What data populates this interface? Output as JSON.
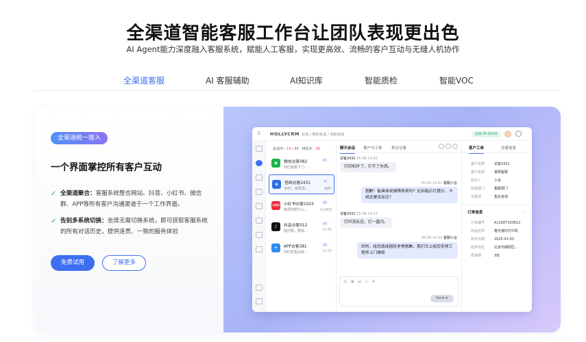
{
  "hero": {
    "title": "全渠道智能客服工作台让团队表现更出色",
    "subtitle": "AI Agent能力深度融入客服系统，赋能人工客服，实现更高效、流畅的客户互动与无缝人机协作"
  },
  "tabs": [
    {
      "label": "全渠道客服",
      "active": true
    },
    {
      "label": "AI 客服辅助",
      "active": false
    },
    {
      "label": "AI知识库",
      "active": false
    },
    {
      "label": "智能质检",
      "active": false
    },
    {
      "label": "智能VOC",
      "active": false
    }
  ],
  "feature_panel": {
    "pill": "全渠道统一接入",
    "title": "一个界面掌控所有客户互动",
    "features": [
      {
        "bold": "全渠道聚合：",
        "text": "客服系统整合网站、抖音、小红书、微信群、APP等所有客户沟通渠道于一个工作界面。"
      },
      {
        "bold": "告别多系统切换：",
        "text": "坐席无需切换系统，即可获取客服系统的所有对话历史，提供连贯、一致的服务体验"
      }
    ],
    "primary_button": "免费试用",
    "secondary_button": "了解更多"
  },
  "colors": {
    "accent": "#3d6ff0",
    "check": "#22a786",
    "queue_red": "#e8474a"
  },
  "app": {
    "brand": "HOLLYCRM",
    "breadcrumb": "在线 / 我的会话 / 当前会话",
    "status": "在线 00:00:00",
    "stats": {
      "serving_label": "会话中：",
      "serving": "14",
      "serving_max": "99",
      "queue_label": "排队中：",
      "queue": "99"
    },
    "conversations": [
      {
        "name": "微信访客082",
        "badge": "AI",
        "preview": "你们客服下门…",
        "time": "",
        "icon": "wechat-icon",
        "color": "#19b34b",
        "glyph": "◉",
        "selected": false
      },
      {
        "name": "官网访客2431",
        "badge": "AI",
        "preview": "好的，给您选…",
        "time": "刚刚",
        "icon": "web-icon",
        "color": "#2f6fe8",
        "glyph": "e",
        "selected": true
      },
      {
        "name": "小红书访客1023",
        "badge": "AI",
        "preview": "麻烦您帮什么…",
        "time": "1分钟前",
        "icon": "xiaohongshu-icon",
        "color": "#ec2d3a",
        "glyph": "小红书",
        "selected": false
      },
      {
        "name": "抖音访客012",
        "badge": "AI",
        "preview": "能问题，那我…",
        "time": "11:45",
        "icon": "douyin-icon",
        "color": "#111111",
        "glyph": "♪",
        "selected": false
      },
      {
        "name": "APP访客381",
        "badge": "AI",
        "preview": "你们的售后有…",
        "time": "11:32",
        "icon": "app-icon",
        "color": "#2d8cf0",
        "glyph": "✦",
        "selected": false
      }
    ],
    "chat_tabs": [
      "聊天会话",
      "客户与工单",
      "来访记录"
    ],
    "messages": [
      {
        "dir": "in",
        "who": "访客2431",
        "time": "05-06 13:45",
        "text": "打印机坏了，打不了东西。"
      },
      {
        "dir": "out",
        "who": "客服小合",
        "time": "05-06 14:02",
        "text": "抱歉！能具体说故障表现吗？比如指示灯提示、卡纸还是没反应？"
      },
      {
        "dir": "in",
        "who": "访客2431",
        "time": "05-06 14:22",
        "text": "打印没反应，灯一直闪。"
      },
      {
        "dir": "out",
        "who": "客服小合",
        "time": "05-06 14:30",
        "text": "好的，给您造成困扰非常抱歉，我们马上给您安排工程师上门维修"
      }
    ],
    "send_label": "Send",
    "side_tabs": [
      "客户工单",
      "访客信息"
    ],
    "customer_fields": [
      {
        "k": "客户名称",
        "v": "访客2431"
      },
      {
        "k": "客户来源",
        "v": "官网客服"
      },
      {
        "k": "经办人",
        "v": "小合"
      },
      {
        "k": "所属部门",
        "v": "客服部门"
      },
      {
        "k": "关键词",
        "v": "售后咨询"
      }
    ],
    "order_section": "订单信息",
    "order_fields": [
      {
        "k": "订单编号",
        "v": "A12087163612"
      },
      {
        "k": "商品名称",
        "v": "格光速印打印机"
      },
      {
        "k": "购买日期",
        "v": "2025-01-03"
      },
      {
        "k": "收货地址",
        "v": "北京市朝阳区…"
      },
      {
        "k": "质保期",
        "v": "3年"
      }
    ]
  }
}
